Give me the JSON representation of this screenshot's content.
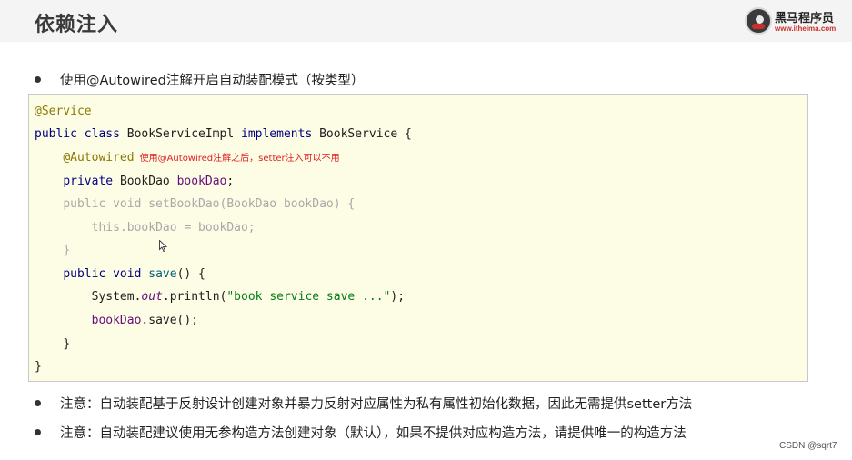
{
  "header": {
    "title": "依赖注入",
    "logo_name": "黑马程序员",
    "logo_url": "www.itheima.com"
  },
  "bullets": [
    "使用@Autowired注解开启自动装配模式（按类型）",
    "注意：自动装配基于反射设计创建对象并暴力反射对应属性为私有属性初始化数据，因此无需提供setter方法",
    "注意：自动装配建议使用无参构造方法创建对象（默认），如果不提供对应构造方法，请提供唯一的构造方法"
  ],
  "code": {
    "l1_annotation": "@Service",
    "l2_public": "public ",
    "l2_class": "class ",
    "l2_name": "BookServiceImpl ",
    "l2_implements": "implements ",
    "l2_iface": "BookService {",
    "l3_annotation": "@Autowired",
    "l3_note": "使用@Autowired注解之后，setter注入可以不用",
    "l4_private": "private ",
    "l4_type": "BookDao ",
    "l4_field": "bookDao",
    "l4_end": ";",
    "l5": "public void setBookDao(BookDao bookDao) {",
    "l6": "this.bookDao = bookDao;",
    "l7": "}",
    "l8_public": "public ",
    "l8_void": "void ",
    "l8_method": "save",
    "l8_end": "() {",
    "l9_system": "System.",
    "l9_out": "out",
    "l9_println": ".println(",
    "l9_string": "\"book service save ...\"",
    "l9_end": ");",
    "l10_field": "bookDao",
    "l10_end": ".save();",
    "l11": "}",
    "l12": "}"
  },
  "watermark": "CSDN @sqrt7",
  "icons": [
    "logo-mark",
    "mouse-cursor-icon",
    "bullet-dot"
  ]
}
